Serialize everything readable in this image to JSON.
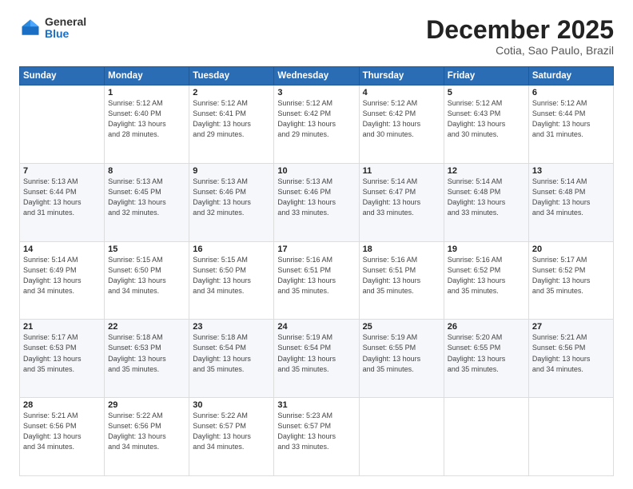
{
  "header": {
    "logo_general": "General",
    "logo_blue": "Blue",
    "month": "December 2025",
    "location": "Cotia, Sao Paulo, Brazil"
  },
  "weekdays": [
    "Sunday",
    "Monday",
    "Tuesday",
    "Wednesday",
    "Thursday",
    "Friday",
    "Saturday"
  ],
  "weeks": [
    [
      {
        "day": "",
        "info": ""
      },
      {
        "day": "1",
        "info": "Sunrise: 5:12 AM\nSunset: 6:40 PM\nDaylight: 13 hours\nand 28 minutes."
      },
      {
        "day": "2",
        "info": "Sunrise: 5:12 AM\nSunset: 6:41 PM\nDaylight: 13 hours\nand 29 minutes."
      },
      {
        "day": "3",
        "info": "Sunrise: 5:12 AM\nSunset: 6:42 PM\nDaylight: 13 hours\nand 29 minutes."
      },
      {
        "day": "4",
        "info": "Sunrise: 5:12 AM\nSunset: 6:42 PM\nDaylight: 13 hours\nand 30 minutes."
      },
      {
        "day": "5",
        "info": "Sunrise: 5:12 AM\nSunset: 6:43 PM\nDaylight: 13 hours\nand 30 minutes."
      },
      {
        "day": "6",
        "info": "Sunrise: 5:12 AM\nSunset: 6:44 PM\nDaylight: 13 hours\nand 31 minutes."
      }
    ],
    [
      {
        "day": "7",
        "info": "Sunrise: 5:13 AM\nSunset: 6:44 PM\nDaylight: 13 hours\nand 31 minutes."
      },
      {
        "day": "8",
        "info": "Sunrise: 5:13 AM\nSunset: 6:45 PM\nDaylight: 13 hours\nand 32 minutes."
      },
      {
        "day": "9",
        "info": "Sunrise: 5:13 AM\nSunset: 6:46 PM\nDaylight: 13 hours\nand 32 minutes."
      },
      {
        "day": "10",
        "info": "Sunrise: 5:13 AM\nSunset: 6:46 PM\nDaylight: 13 hours\nand 33 minutes."
      },
      {
        "day": "11",
        "info": "Sunrise: 5:14 AM\nSunset: 6:47 PM\nDaylight: 13 hours\nand 33 minutes."
      },
      {
        "day": "12",
        "info": "Sunrise: 5:14 AM\nSunset: 6:48 PM\nDaylight: 13 hours\nand 33 minutes."
      },
      {
        "day": "13",
        "info": "Sunrise: 5:14 AM\nSunset: 6:48 PM\nDaylight: 13 hours\nand 34 minutes."
      }
    ],
    [
      {
        "day": "14",
        "info": "Sunrise: 5:14 AM\nSunset: 6:49 PM\nDaylight: 13 hours\nand 34 minutes."
      },
      {
        "day": "15",
        "info": "Sunrise: 5:15 AM\nSunset: 6:50 PM\nDaylight: 13 hours\nand 34 minutes."
      },
      {
        "day": "16",
        "info": "Sunrise: 5:15 AM\nSunset: 6:50 PM\nDaylight: 13 hours\nand 34 minutes."
      },
      {
        "day": "17",
        "info": "Sunrise: 5:16 AM\nSunset: 6:51 PM\nDaylight: 13 hours\nand 35 minutes."
      },
      {
        "day": "18",
        "info": "Sunrise: 5:16 AM\nSunset: 6:51 PM\nDaylight: 13 hours\nand 35 minutes."
      },
      {
        "day": "19",
        "info": "Sunrise: 5:16 AM\nSunset: 6:52 PM\nDaylight: 13 hours\nand 35 minutes."
      },
      {
        "day": "20",
        "info": "Sunrise: 5:17 AM\nSunset: 6:52 PM\nDaylight: 13 hours\nand 35 minutes."
      }
    ],
    [
      {
        "day": "21",
        "info": "Sunrise: 5:17 AM\nSunset: 6:53 PM\nDaylight: 13 hours\nand 35 minutes."
      },
      {
        "day": "22",
        "info": "Sunrise: 5:18 AM\nSunset: 6:53 PM\nDaylight: 13 hours\nand 35 minutes."
      },
      {
        "day": "23",
        "info": "Sunrise: 5:18 AM\nSunset: 6:54 PM\nDaylight: 13 hours\nand 35 minutes."
      },
      {
        "day": "24",
        "info": "Sunrise: 5:19 AM\nSunset: 6:54 PM\nDaylight: 13 hours\nand 35 minutes."
      },
      {
        "day": "25",
        "info": "Sunrise: 5:19 AM\nSunset: 6:55 PM\nDaylight: 13 hours\nand 35 minutes."
      },
      {
        "day": "26",
        "info": "Sunrise: 5:20 AM\nSunset: 6:55 PM\nDaylight: 13 hours\nand 35 minutes."
      },
      {
        "day": "27",
        "info": "Sunrise: 5:21 AM\nSunset: 6:56 PM\nDaylight: 13 hours\nand 34 minutes."
      }
    ],
    [
      {
        "day": "28",
        "info": "Sunrise: 5:21 AM\nSunset: 6:56 PM\nDaylight: 13 hours\nand 34 minutes."
      },
      {
        "day": "29",
        "info": "Sunrise: 5:22 AM\nSunset: 6:56 PM\nDaylight: 13 hours\nand 34 minutes."
      },
      {
        "day": "30",
        "info": "Sunrise: 5:22 AM\nSunset: 6:57 PM\nDaylight: 13 hours\nand 34 minutes."
      },
      {
        "day": "31",
        "info": "Sunrise: 5:23 AM\nSunset: 6:57 PM\nDaylight: 13 hours\nand 33 minutes."
      },
      {
        "day": "",
        "info": ""
      },
      {
        "day": "",
        "info": ""
      },
      {
        "day": "",
        "info": ""
      }
    ]
  ]
}
